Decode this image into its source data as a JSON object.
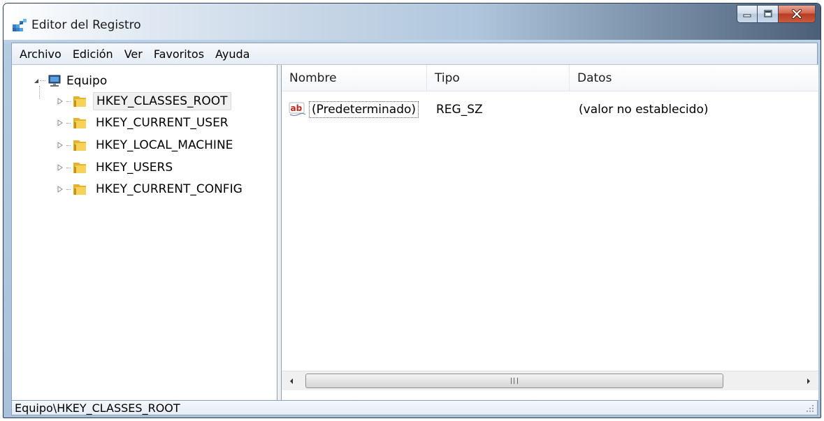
{
  "window": {
    "title": "Editor del Registro",
    "icon": "regedit-icon"
  },
  "caption": {
    "minimize_icon": "minimize-icon",
    "maximize_icon": "maximize-icon",
    "close_icon": "close-icon"
  },
  "menu": {
    "items": [
      "Archivo",
      "Edición",
      "Ver",
      "Favoritos",
      "Ayuda"
    ]
  },
  "tree": {
    "root": {
      "label": "Equipo",
      "icon": "computer-icon",
      "expanded": true
    },
    "items": [
      {
        "label": "HKEY_CLASSES_ROOT",
        "selected": true
      },
      {
        "label": "HKEY_CURRENT_USER",
        "selected": false
      },
      {
        "label": "HKEY_LOCAL_MACHINE",
        "selected": false
      },
      {
        "label": "HKEY_USERS",
        "selected": false
      },
      {
        "label": "HKEY_CURRENT_CONFIG",
        "selected": false
      }
    ]
  },
  "list": {
    "columns": [
      "Nombre",
      "Tipo",
      "Datos"
    ],
    "rows": [
      {
        "name": "(Predeterminado)",
        "type": "REG_SZ",
        "data": "(valor no establecido)",
        "icon": "string-value-icon"
      }
    ]
  },
  "status": {
    "path": "Equipo\\HKEY_CLASSES_ROOT"
  },
  "colors": {
    "folder": "#f3c53c",
    "selection_bg": "#f0f0f0",
    "close_button": "#c7502f"
  }
}
